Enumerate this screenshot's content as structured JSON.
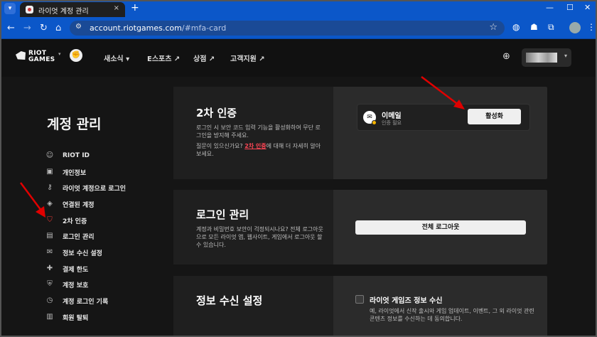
{
  "browser": {
    "tab_title": "라이엇 계정 관리",
    "tab_close": "×",
    "new_tab": "+",
    "address_host": "account.riotgames.com",
    "address_path": "/#mfa-card",
    "win_min": "—",
    "win_max": "☐",
    "win_close": "✕"
  },
  "nav": {
    "logo_line1": "RIOT",
    "logo_line2": "GAMES",
    "links": [
      "새소식 ▾",
      "E스포츠 ↗",
      "상점 ↗",
      "고객지원 ↗"
    ]
  },
  "sidebar": {
    "title": "계정 관리",
    "items": [
      {
        "label": "RIOT ID",
        "icon": "☺"
      },
      {
        "label": "개인정보",
        "icon": "▣"
      },
      {
        "label": "라이엇 계정으로 로그인",
        "icon": "⚷"
      },
      {
        "label": "연결된 계정",
        "icon": "◈"
      },
      {
        "label": "2차 인증",
        "icon": "⛉"
      },
      {
        "label": "로그인 관리",
        "icon": "▤"
      },
      {
        "label": "정보 수신 설정",
        "icon": "✉"
      },
      {
        "label": "결제 한도",
        "icon": "✚"
      },
      {
        "label": "계정 보호",
        "icon": "⛨"
      },
      {
        "label": "계정 로그인 기록",
        "icon": "◷"
      },
      {
        "label": "회원 탈퇴",
        "icon": "▥"
      }
    ]
  },
  "mfa_card": {
    "title": "2차 인증",
    "desc": "로그인 시 보안 코드 입력 기능을 활성화하여 무단 로그인을 방지해 주세요.",
    "help_prefix": "질문이 있으신가요? ",
    "help_link": "2차 인증",
    "help_suffix": "에 대해 더 자세히 알아보세요.",
    "email_title": "이메일",
    "email_status": "인증 필요",
    "activate_button": "활성화"
  },
  "login_card": {
    "title": "로그인 관리",
    "desc": "계정과 비밀번호 보안이 걱정되시나요? 전체 로그아웃으로 모든 라이엇 앱, 웹사이트, 게임에서 로그아웃 할 수 있습니다.",
    "logout_button": "전체 로그아웃"
  },
  "comm_card": {
    "title": "정보 수신 설정",
    "checkbox_label": "라이엇 게임즈 정보 수신",
    "checkbox_desc": "예, 라이엇에서 신작 출시와 게임 업데이트, 이벤트, 그 외 라이엇 관련 콘텐츠 정보를 수신하는 데 동의합니다."
  },
  "colors": {
    "accent_red": "#ff4655",
    "annotation_arrow": "#e00000",
    "browser_blue": "#0b57c9"
  }
}
